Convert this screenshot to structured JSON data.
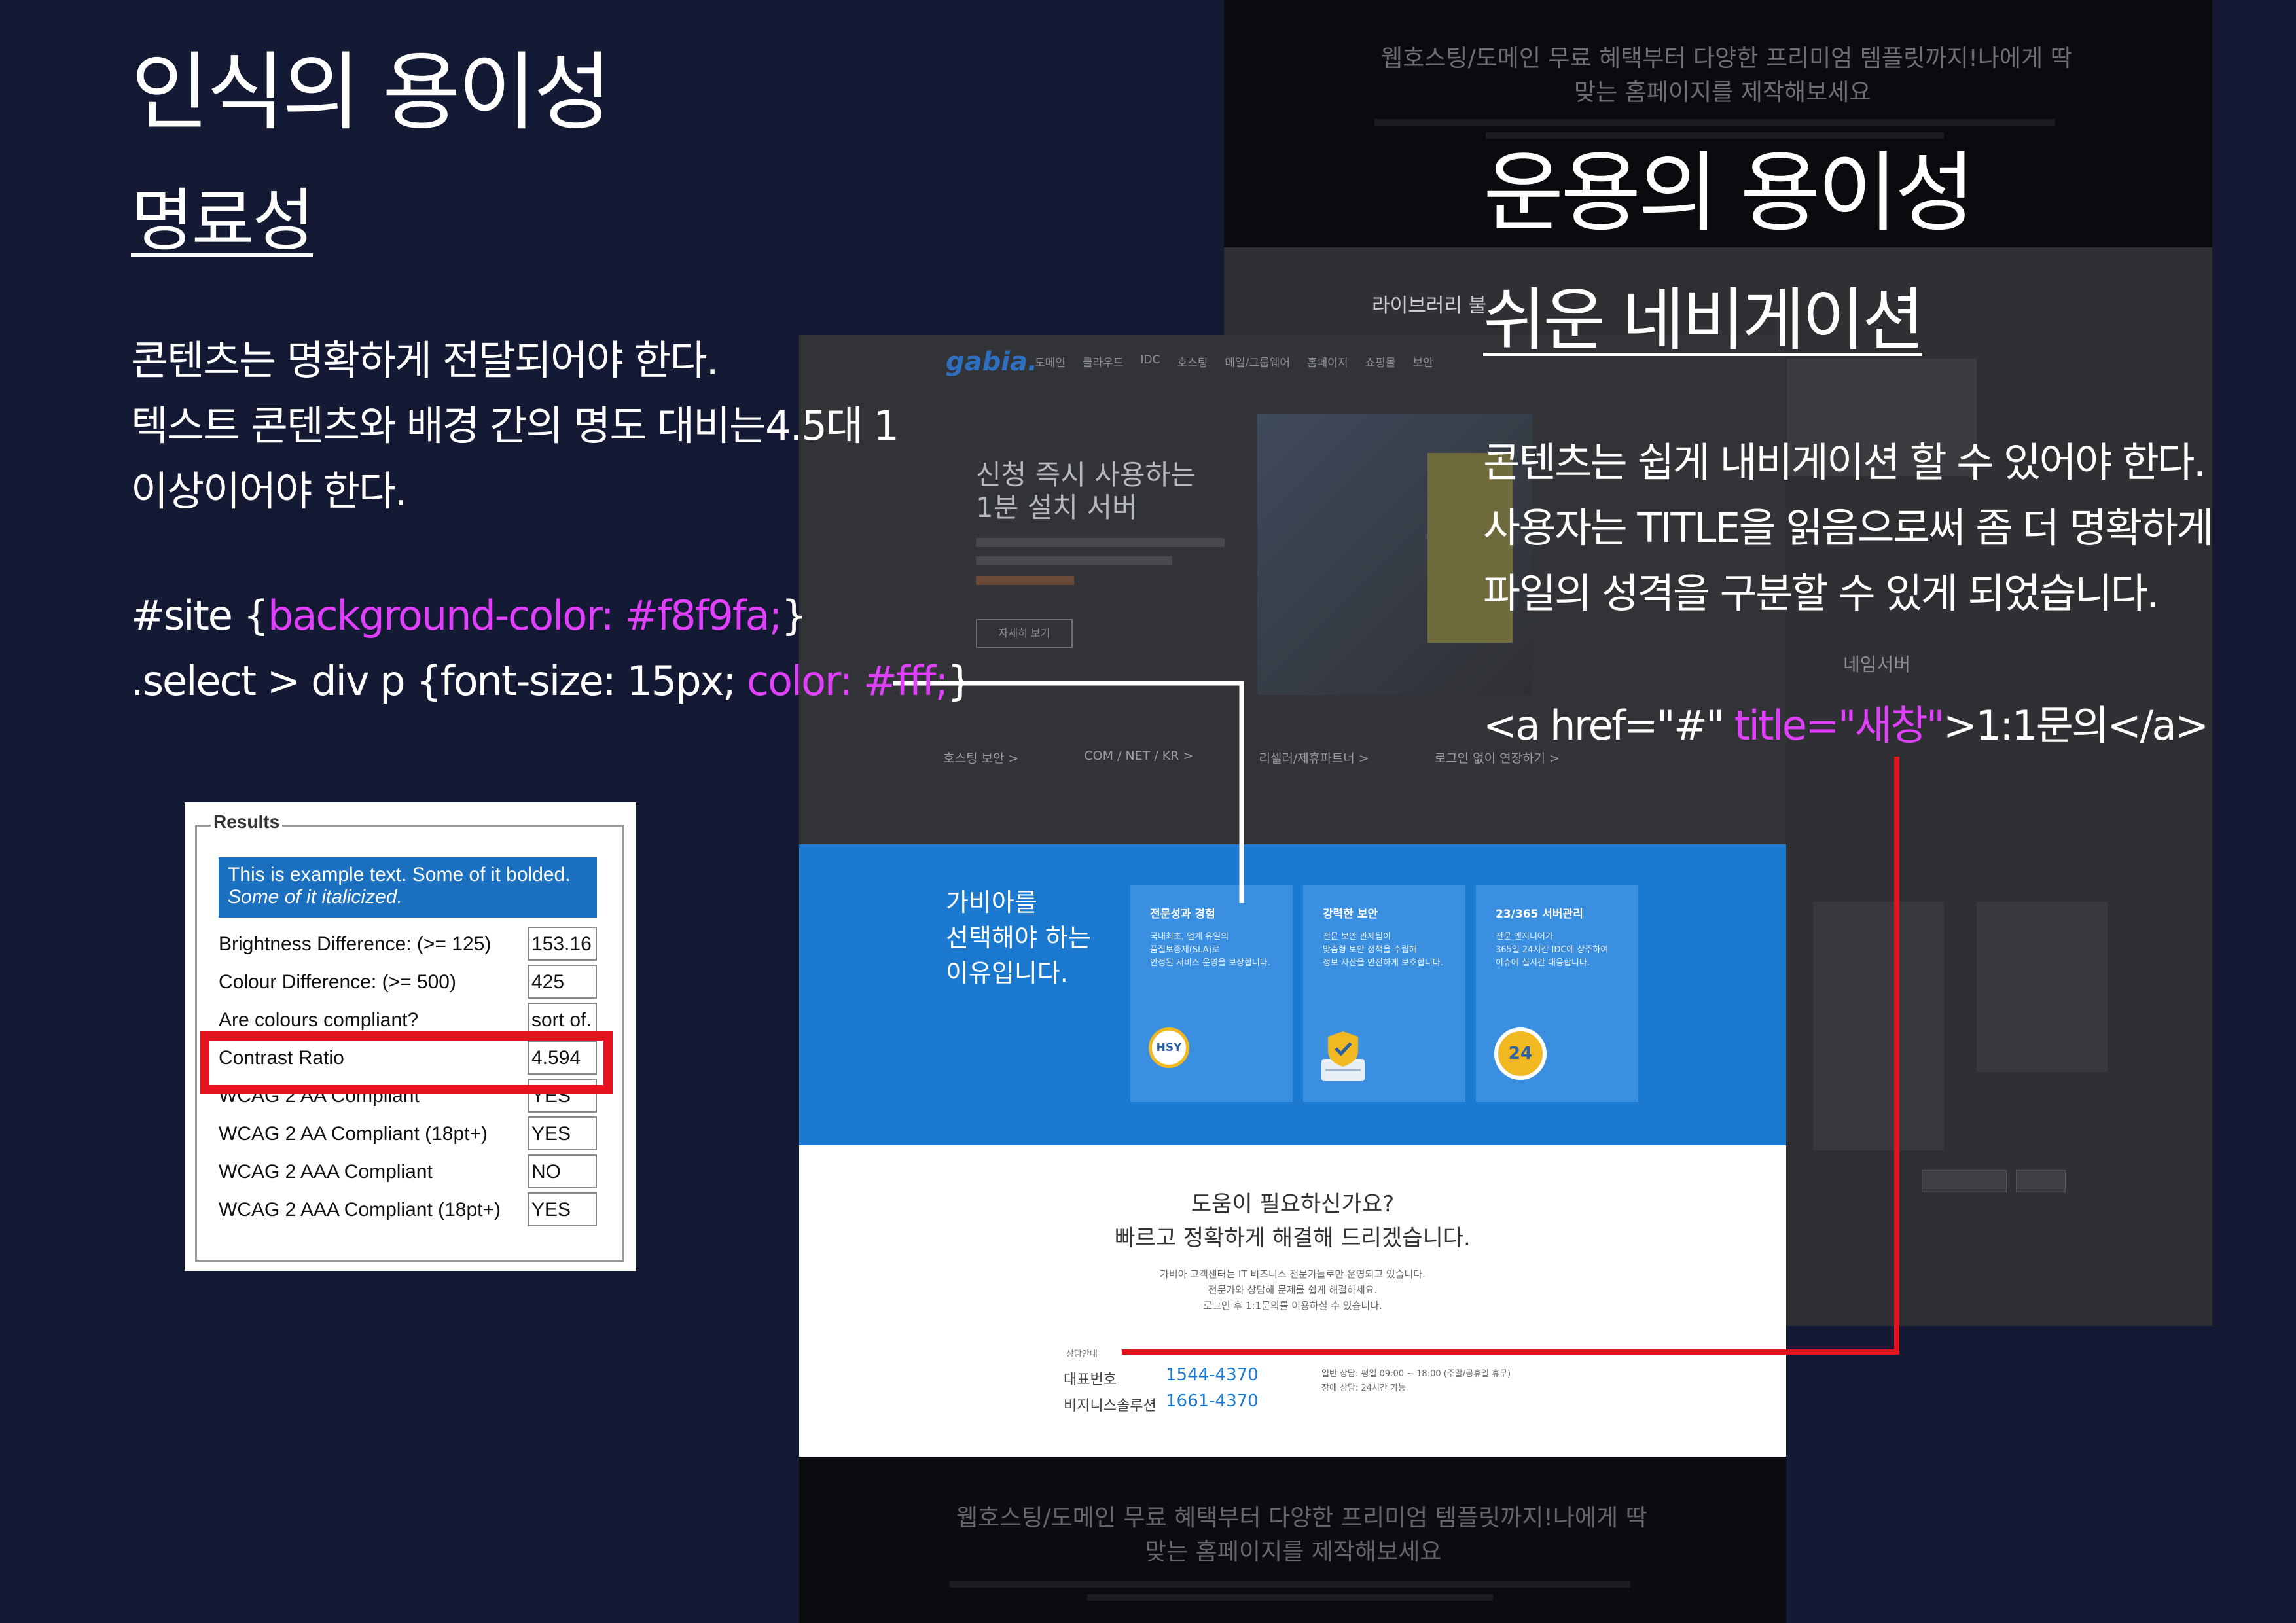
{
  "colors": {
    "background": "#141a33",
    "highlight": "#e040fb",
    "connector_white": "#ffffff",
    "connector_red": "#e2141e",
    "site_blue": "#1b79d0"
  },
  "left": {
    "title": "인식의 용이성",
    "subtitle": "명료성",
    "lines": [
      "콘텐츠는 명확하게 전달되어야 한다.",
      "텍스트 콘텐츠와 배경 간의 명도 대비는4.5대 1",
      "이상이어야 한다."
    ],
    "code1": {
      "pre": "#site {",
      "hl": "background-color: #f8f9fa;",
      "post": "}"
    },
    "code2": {
      "pre": ".select > div p {font-size: 15px; ",
      "hl": "color: #fff;",
      "post": "}"
    }
  },
  "results": {
    "legend": "Results",
    "sample_line1": "This is example text. Some of it bolded.",
    "sample_line2": "Some of it italicized.",
    "rows": [
      {
        "label": "Brightness Difference: (>= 125)",
        "value": "153.16"
      },
      {
        "label": "Colour Difference: (>= 500)",
        "value": "425"
      },
      {
        "label": "Are colours compliant?",
        "value": "sort of."
      },
      {
        "label": "Contrast Ratio",
        "value": "4.594"
      },
      {
        "label": "WCAG 2 AA Compliant",
        "value": "YES"
      },
      {
        "label": "WCAG 2 AA Compliant (18pt+)",
        "value": "YES"
      },
      {
        "label": "WCAG 2 AAA Compliant",
        "value": "NO"
      },
      {
        "label": "WCAG 2 AAA Compliant (18pt+)",
        "value": "YES"
      }
    ]
  },
  "right": {
    "title": "운용의 용이성",
    "subtitle": "쉬운 네비게이션",
    "lines": [
      "콘텐츠는 쉽게 내비게이션 할 수 있어야 한다.",
      "사용자는 TITLE을 읽음으로써 좀 더 명확하게",
      "파일의 성격을 구분할 수 있게 되었습니다."
    ],
    "code": {
      "pre": "<a href=\"#\" ",
      "hl": "title=\"새창\"",
      "post": ">1:1문의</a>"
    }
  },
  "site": {
    "banner_line1": "웹호스팅/도메인 무료 혜택부터 다양한 프리미엄 템플릿까지!나에게 딱",
    "banner_line2": "맞는 홈페이지를 제작해보세요",
    "logo": "gabia.",
    "nav": [
      "도메인",
      "클라우드",
      "IDC",
      "호스팅",
      "메일/그룹웨어",
      "홈페이지",
      "쇼핑몰",
      "보안"
    ],
    "hero_line1": "신청 즉시 사용하는",
    "hero_line2": "1분 설치 서버",
    "hero_button": "자세히 보기",
    "library_label": "라이브러리 불",
    "nameserver": "네임서버",
    "bottom_links": [
      "호스팅 보안 >",
      "COM / NET / KR >",
      "리셀러/제휴파트너 >",
      "로그인 없이 연장하기 >"
    ],
    "why_line1": "가비아를",
    "why_line2": "선택해야 하는",
    "why_line3": "이유입니다.",
    "cards": [
      {
        "title": "전문성과 경험",
        "desc": "국내최초, 업계 유일의\n품질보증제(SLA)로\n안정된 서비스 운영을 보장합니다.",
        "icon": "medal-icon",
        "badge": "HSY"
      },
      {
        "title": "강력한 보안",
        "desc": "전문 보안 관제팀이\n맞춤형 보안 정책을 수립해\n정보 자산을 안전하게 보호합니다.",
        "icon": "shield-server-icon"
      },
      {
        "title": "23/365 서버관리",
        "desc": "전문 엔지니어가\n365일 24시간 IDC에 상주하여\n이슈에 실시간 대응합니다.",
        "icon": "clock-24-icon",
        "badge": "24"
      }
    ],
    "help_line1": "도움이 필요하신가요?",
    "help_line2": "빠르고 정확하게 해결해 드리겠습니다.",
    "help_desc1": "가비아 고객센터는 IT 비즈니스 전문가들로만 운영되고 있습니다.",
    "help_desc2": "전문가와 상담해 문제를 쉽게 해결하세요.",
    "help_desc3": "로그인 후 1:1문의를 이용하실 수 있습니다.",
    "contact_label": "상담안내",
    "phones": [
      {
        "label": "대표번호",
        "number": "1544-4370"
      },
      {
        "label": "비지니스솔루션",
        "number": "1661-4370"
      }
    ],
    "hours1": "일반 상담: 평일 09:00 ~ 18:00 (주말/공휴일 휴무)",
    "hours2": "장애 상담: 24시간 가능"
  }
}
